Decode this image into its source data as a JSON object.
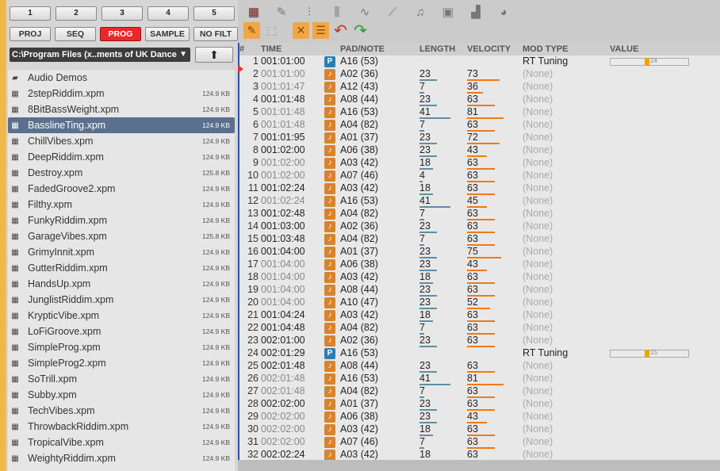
{
  "top_buttons": [
    "1",
    "2",
    "3",
    "4",
    "5"
  ],
  "modes": [
    {
      "label": "PROJ",
      "active": false
    },
    {
      "label": "SEQ",
      "active": false
    },
    {
      "label": "PROG",
      "active": true
    },
    {
      "label": "SAMPLE",
      "active": false
    },
    {
      "label": "NO FILT",
      "active": false
    }
  ],
  "browser": {
    "path": "C:\\Program Files (x..ments of UK Dance",
    "up_label": "⬆",
    "files": [
      {
        "name": "Audio Demos",
        "size": "",
        "type": "folder"
      },
      {
        "name": "2stepRiddim.xpm",
        "size": "124.9 KB",
        "type": "file"
      },
      {
        "name": "8BitBassWeight.xpm",
        "size": "124.9 KB",
        "type": "file"
      },
      {
        "name": "BasslineTing.xpm",
        "size": "124.9 KB",
        "type": "file",
        "selected": true
      },
      {
        "name": "ChillVibes.xpm",
        "size": "124.9 KB",
        "type": "file"
      },
      {
        "name": "DeepRiddim.xpm",
        "size": "124.9 KB",
        "type": "file"
      },
      {
        "name": "Destroy.xpm",
        "size": "125.8 KB",
        "type": "file"
      },
      {
        "name": "FadedGroove2.xpm",
        "size": "124.9 KB",
        "type": "file"
      },
      {
        "name": "Filthy.xpm",
        "size": "124.9 KB",
        "type": "file"
      },
      {
        "name": "FunkyRiddim.xpm",
        "size": "124.9 KB",
        "type": "file"
      },
      {
        "name": "GarageVibes.xpm",
        "size": "125.8 KB",
        "type": "file"
      },
      {
        "name": "GrimyInnit.xpm",
        "size": "124.9 KB",
        "type": "file"
      },
      {
        "name": "GutterRiddim.xpm",
        "size": "124.9 KB",
        "type": "file"
      },
      {
        "name": "HandsUp.xpm",
        "size": "124.9 KB",
        "type": "file"
      },
      {
        "name": "JunglistRiddim.xpm",
        "size": "124.9 KB",
        "type": "file"
      },
      {
        "name": "KrypticVibe.xpm",
        "size": "124.9 KB",
        "type": "file"
      },
      {
        "name": "LoFiGroove.xpm",
        "size": "124.9 KB",
        "type": "file"
      },
      {
        "name": "SimpleProg.xpm",
        "size": "124.9 KB",
        "type": "file"
      },
      {
        "name": "SimpleProg2.xpm",
        "size": "124.9 KB",
        "type": "file"
      },
      {
        "name": "SoTrill.xpm",
        "size": "124.9 KB",
        "type": "file"
      },
      {
        "name": "Subby.xpm",
        "size": "124.9 KB",
        "type": "file"
      },
      {
        "name": "TechVibes.xpm",
        "size": "124.9 KB",
        "type": "file"
      },
      {
        "name": "ThrowbackRiddim.xpm",
        "size": "124.9 KB",
        "type": "file"
      },
      {
        "name": "TropicalVibe.xpm",
        "size": "124.9 KB",
        "type": "file"
      },
      {
        "name": "WeightyRiddim.xpm",
        "size": "124.9 KB",
        "type": "file"
      }
    ]
  },
  "toolbar_icons": [
    "grid-icon",
    "pencil-icon",
    "mixer-icon",
    "step-icon",
    "waveform-icon",
    "wand-icon",
    "note-icon",
    "mute-icon",
    "stairs-icon",
    "clock-icon"
  ],
  "toolbar2_icons": [
    "pencil-select-icon",
    "marquee-icon",
    "close-icon",
    "list-icon",
    "undo-icon",
    "redo-icon"
  ],
  "table": {
    "headers": {
      "idx": "#",
      "time": "TIME",
      "pad": "PAD/NOTE",
      "length": "LENGTH",
      "velocity": "VELOCITY",
      "mod": "MOD TYPE",
      "value": "VALUE"
    },
    "rows": [
      {
        "idx": "1",
        "time": "001:01:00",
        "dim": false,
        "icon": "P",
        "pad": "A16 (53)",
        "length": "",
        "len_frac": 0,
        "velocity": "",
        "vel_frac": 0,
        "mod": "RT Tuning",
        "mod_on": true,
        "value": "24",
        "val_frac": 0.46
      },
      {
        "idx": "2",
        "time": "001:01:00",
        "dim": true,
        "icon": "♪",
        "pad": "A02 (36)",
        "length": "23",
        "len_frac": 0.4,
        "velocity": "73",
        "vel_frac": 0.69,
        "mod": "(None)",
        "mod_on": false
      },
      {
        "idx": "3",
        "time": "001:01:47",
        "dim": true,
        "icon": "♪",
        "pad": "A12 (43)",
        "length": "7",
        "len_frac": 0.12,
        "velocity": "36",
        "vel_frac": 0.34,
        "mod": "(None)",
        "mod_on": false
      },
      {
        "idx": "4",
        "time": "001:01:48",
        "dim": false,
        "icon": "♪",
        "pad": "A08 (44)",
        "length": "23",
        "len_frac": 0.4,
        "velocity": "63",
        "vel_frac": 0.59,
        "mod": "(None)",
        "mod_on": false
      },
      {
        "idx": "5",
        "time": "001:01:48",
        "dim": true,
        "icon": "♪",
        "pad": "A16 (53)",
        "length": "41",
        "len_frac": 0.72,
        "velocity": "81",
        "vel_frac": 0.76,
        "mod": "(None)",
        "mod_on": false
      },
      {
        "idx": "6",
        "time": "001:01:48",
        "dim": true,
        "icon": "♪",
        "pad": "A04 (82)",
        "length": "7",
        "len_frac": 0.12,
        "velocity": "63",
        "vel_frac": 0.59,
        "mod": "(None)",
        "mod_on": false
      },
      {
        "idx": "7",
        "time": "001:01:95",
        "dim": false,
        "icon": "♪",
        "pad": "A01 (37)",
        "length": "23",
        "len_frac": 0.4,
        "velocity": "72",
        "vel_frac": 0.68,
        "mod": "(None)",
        "mod_on": false
      },
      {
        "idx": "8",
        "time": "001:02:00",
        "dim": false,
        "icon": "♪",
        "pad": "A06 (38)",
        "length": "23",
        "len_frac": 0.4,
        "velocity": "43",
        "vel_frac": 0.41,
        "mod": "(None)",
        "mod_on": false
      },
      {
        "idx": "9",
        "time": "001:02:00",
        "dim": true,
        "icon": "♪",
        "pad": "A03 (42)",
        "length": "18",
        "len_frac": 0.32,
        "velocity": "63",
        "vel_frac": 0.59,
        "mod": "(None)",
        "mod_on": false
      },
      {
        "idx": "10",
        "time": "001:02:00",
        "dim": true,
        "icon": "♪",
        "pad": "A07 (46)",
        "length": "4",
        "len_frac": 0.07,
        "velocity": "63",
        "vel_frac": 0.59,
        "mod": "(None)",
        "mod_on": false
      },
      {
        "idx": "11",
        "time": "001:02:24",
        "dim": false,
        "icon": "♪",
        "pad": "A03 (42)",
        "length": "18",
        "len_frac": 0.32,
        "velocity": "63",
        "vel_frac": 0.59,
        "mod": "(None)",
        "mod_on": false
      },
      {
        "idx": "12",
        "time": "001:02:24",
        "dim": true,
        "icon": "♪",
        "pad": "A16 (53)",
        "length": "41",
        "len_frac": 0.72,
        "velocity": "45",
        "vel_frac": 0.42,
        "mod": "(None)",
        "mod_on": false
      },
      {
        "idx": "13",
        "time": "001:02:48",
        "dim": false,
        "icon": "♪",
        "pad": "A04 (82)",
        "length": "7",
        "len_frac": 0.12,
        "velocity": "63",
        "vel_frac": 0.59,
        "mod": "(None)",
        "mod_on": false
      },
      {
        "idx": "14",
        "time": "001:03:00",
        "dim": false,
        "icon": "♪",
        "pad": "A02 (36)",
        "length": "23",
        "len_frac": 0.4,
        "velocity": "63",
        "vel_frac": 0.59,
        "mod": "(None)",
        "mod_on": false
      },
      {
        "idx": "15",
        "time": "001:03:48",
        "dim": false,
        "icon": "♪",
        "pad": "A04 (82)",
        "length": "7",
        "len_frac": 0.12,
        "velocity": "63",
        "vel_frac": 0.59,
        "mod": "(None)",
        "mod_on": false
      },
      {
        "idx": "16",
        "time": "001:04:00",
        "dim": false,
        "icon": "♪",
        "pad": "A01 (37)",
        "length": "23",
        "len_frac": 0.4,
        "velocity": "75",
        "vel_frac": 0.71,
        "mod": "(None)",
        "mod_on": false
      },
      {
        "idx": "17",
        "time": "001:04:00",
        "dim": true,
        "icon": "♪",
        "pad": "A06 (38)",
        "length": "23",
        "len_frac": 0.4,
        "velocity": "43",
        "vel_frac": 0.41,
        "mod": "(None)",
        "mod_on": false
      },
      {
        "idx": "18",
        "time": "001:04:00",
        "dim": true,
        "icon": "♪",
        "pad": "A03 (42)",
        "length": "18",
        "len_frac": 0.32,
        "velocity": "63",
        "vel_frac": 0.59,
        "mod": "(None)",
        "mod_on": false
      },
      {
        "idx": "19",
        "time": "001:04:00",
        "dim": true,
        "icon": "♪",
        "pad": "A08 (44)",
        "length": "23",
        "len_frac": 0.4,
        "velocity": "63",
        "vel_frac": 0.59,
        "mod": "(None)",
        "mod_on": false
      },
      {
        "idx": "20",
        "time": "001:04:00",
        "dim": true,
        "icon": "♪",
        "pad": "A10 (47)",
        "length": "23",
        "len_frac": 0.4,
        "velocity": "52",
        "vel_frac": 0.49,
        "mod": "(None)",
        "mod_on": false
      },
      {
        "idx": "21",
        "time": "001:04:24",
        "dim": false,
        "icon": "♪",
        "pad": "A03 (42)",
        "length": "18",
        "len_frac": 0.32,
        "velocity": "63",
        "vel_frac": 0.59,
        "mod": "(None)",
        "mod_on": false
      },
      {
        "idx": "22",
        "time": "001:04:48",
        "dim": false,
        "icon": "♪",
        "pad": "A04 (82)",
        "length": "7",
        "len_frac": 0.12,
        "velocity": "63",
        "vel_frac": 0.59,
        "mod": "(None)",
        "mod_on": false
      },
      {
        "idx": "23",
        "time": "002:01:00",
        "dim": false,
        "icon": "♪",
        "pad": "A02 (36)",
        "length": "23",
        "len_frac": 0.4,
        "velocity": "63",
        "vel_frac": 0.59,
        "mod": "(None)",
        "mod_on": false
      },
      {
        "idx": "24",
        "time": "002:01:29",
        "dim": false,
        "icon": "P",
        "pad": "A16 (53)",
        "length": "",
        "len_frac": 0,
        "velocity": "",
        "vel_frac": 0,
        "mod": "RT Tuning",
        "mod_on": true,
        "value": "15",
        "val_frac": 0.46
      },
      {
        "idx": "25",
        "time": "002:01:48",
        "dim": false,
        "icon": "♪",
        "pad": "A08 (44)",
        "length": "23",
        "len_frac": 0.4,
        "velocity": "63",
        "vel_frac": 0.59,
        "mod": "(None)",
        "mod_on": false
      },
      {
        "idx": "26",
        "time": "002:01:48",
        "dim": true,
        "icon": "♪",
        "pad": "A16 (53)",
        "length": "41",
        "len_frac": 0.72,
        "velocity": "81",
        "vel_frac": 0.76,
        "mod": "(None)",
        "mod_on": false
      },
      {
        "idx": "27",
        "time": "002:01:48",
        "dim": true,
        "icon": "♪",
        "pad": "A04 (82)",
        "length": "7",
        "len_frac": 0.12,
        "velocity": "63",
        "vel_frac": 0.59,
        "mod": "(None)",
        "mod_on": false
      },
      {
        "idx": "28",
        "time": "002:02:00",
        "dim": false,
        "icon": "♪",
        "pad": "A01 (37)",
        "length": "23",
        "len_frac": 0.4,
        "velocity": "63",
        "vel_frac": 0.59,
        "mod": "(None)",
        "mod_on": false
      },
      {
        "idx": "29",
        "time": "002:02:00",
        "dim": true,
        "icon": "♪",
        "pad": "A06 (38)",
        "length": "23",
        "len_frac": 0.4,
        "velocity": "43",
        "vel_frac": 0.41,
        "mod": "(None)",
        "mod_on": false
      },
      {
        "idx": "30",
        "time": "002:02:00",
        "dim": true,
        "icon": "♪",
        "pad": "A03 (42)",
        "length": "18",
        "len_frac": 0.32,
        "velocity": "63",
        "vel_frac": 0.59,
        "mod": "(None)",
        "mod_on": false
      },
      {
        "idx": "31",
        "time": "002:02:00",
        "dim": true,
        "icon": "♪",
        "pad": "A07 (46)",
        "length": "7",
        "len_frac": 0.12,
        "velocity": "63",
        "vel_frac": 0.59,
        "mod": "(None)",
        "mod_on": false
      },
      {
        "idx": "32",
        "time": "002:02:24",
        "dim": false,
        "icon": "♪",
        "pad": "A03 (42)",
        "length": "18",
        "len_frac": 0.32,
        "velocity": "63",
        "vel_frac": 0.59,
        "mod": "(None)",
        "mod_on": false
      }
    ]
  },
  "colors": {
    "accent": "#e8292c",
    "selection": "#5b6f8e",
    "note_icon": "#d8842c",
    "prog_icon": "#2a7fb0",
    "velocity_bar": "#f07a10",
    "length_bar": "#5a8fa5"
  }
}
